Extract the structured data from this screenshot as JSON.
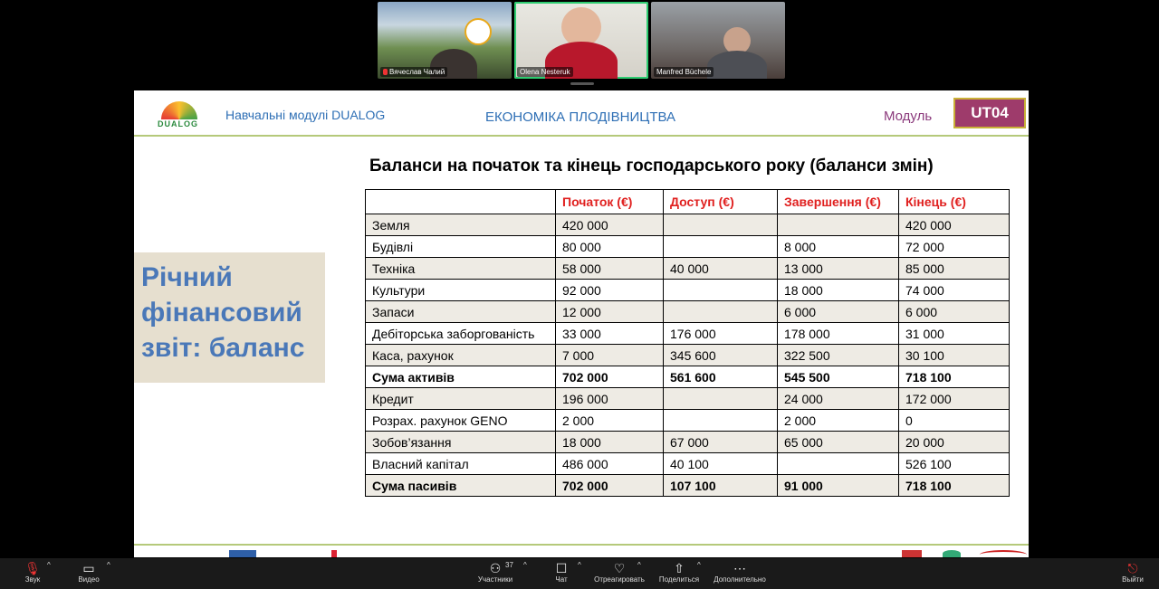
{
  "participants": [
    {
      "name": "Вячеслав Чалий",
      "muted": true
    },
    {
      "name": "Olena Nesteruk",
      "muted": false
    },
    {
      "name": "Manfred Büchele",
      "muted": false
    }
  ],
  "slide": {
    "logo_text": "DUALOG",
    "header_left": "Навчальні модулі DUALOG",
    "header_center": "ЕКОНОМІКА ПЛОДІВНИЦТВА",
    "module_label": "Модуль",
    "module_code": "UT04",
    "side_title": [
      "Річний",
      "фінансовий",
      "звіт: баланс"
    ],
    "table_title": "Баланси на початок та кінець господарського року (баланси змін)",
    "columns": [
      "",
      "Початок (€)",
      "Доступ (€)",
      "Завершення (€)",
      "Кінець (€)"
    ],
    "rows": [
      {
        "cells": [
          "Земля",
          "420 000",
          "",
          "",
          "420 000"
        ],
        "bold": false
      },
      {
        "cells": [
          "Будівлі",
          "80 000",
          "",
          "8 000",
          "72 000"
        ],
        "bold": false
      },
      {
        "cells": [
          "Техніка",
          "58 000",
          "40 000",
          "13 000",
          "85 000"
        ],
        "bold": false
      },
      {
        "cells": [
          "Культури",
          "92 000",
          "",
          "18 000",
          "74 000"
        ],
        "bold": false
      },
      {
        "cells": [
          "Запаси",
          "12 000",
          "",
          "6 000",
          "6 000"
        ],
        "bold": false
      },
      {
        "cells": [
          "Дебіторська заборгованість",
          "33 000",
          "176 000",
          "178 000",
          "31 000"
        ],
        "bold": false
      },
      {
        "cells": [
          "Каса, рахунок",
          "7 000",
          "345 600",
          "322 500",
          "30 100"
        ],
        "bold": false
      },
      {
        "cells": [
          "Сума активів",
          "702 000",
          "561 600",
          "545 500",
          "718 100"
        ],
        "bold": true
      },
      {
        "cells": [
          "Кредит",
          "196 000",
          "",
          "24 000",
          "172 000"
        ],
        "bold": false
      },
      {
        "cells": [
          "Розрах. рахунок GENO",
          "2 000",
          "",
          "2 000",
          "0"
        ],
        "bold": false
      },
      {
        "cells": [
          "Зобов’язання",
          "18 000",
          "67 000",
          "65 000",
          "20 000"
        ],
        "bold": false
      },
      {
        "cells": [
          "Власний капітал",
          "486 000",
          "40 100",
          "",
          "526 100"
        ],
        "bold": false
      },
      {
        "cells": [
          "Сума пасивів",
          "702 000",
          "107 100",
          "91 000",
          "718 100"
        ],
        "bold": true
      }
    ]
  },
  "toolbar": {
    "sound": "Звук",
    "video": "Видео",
    "participants": "Участники",
    "participants_count": "37",
    "chat": "Чат",
    "react": "Отреагировать",
    "share": "Поделиться",
    "more": "Дополнительно",
    "exit": "Выйти"
  }
}
